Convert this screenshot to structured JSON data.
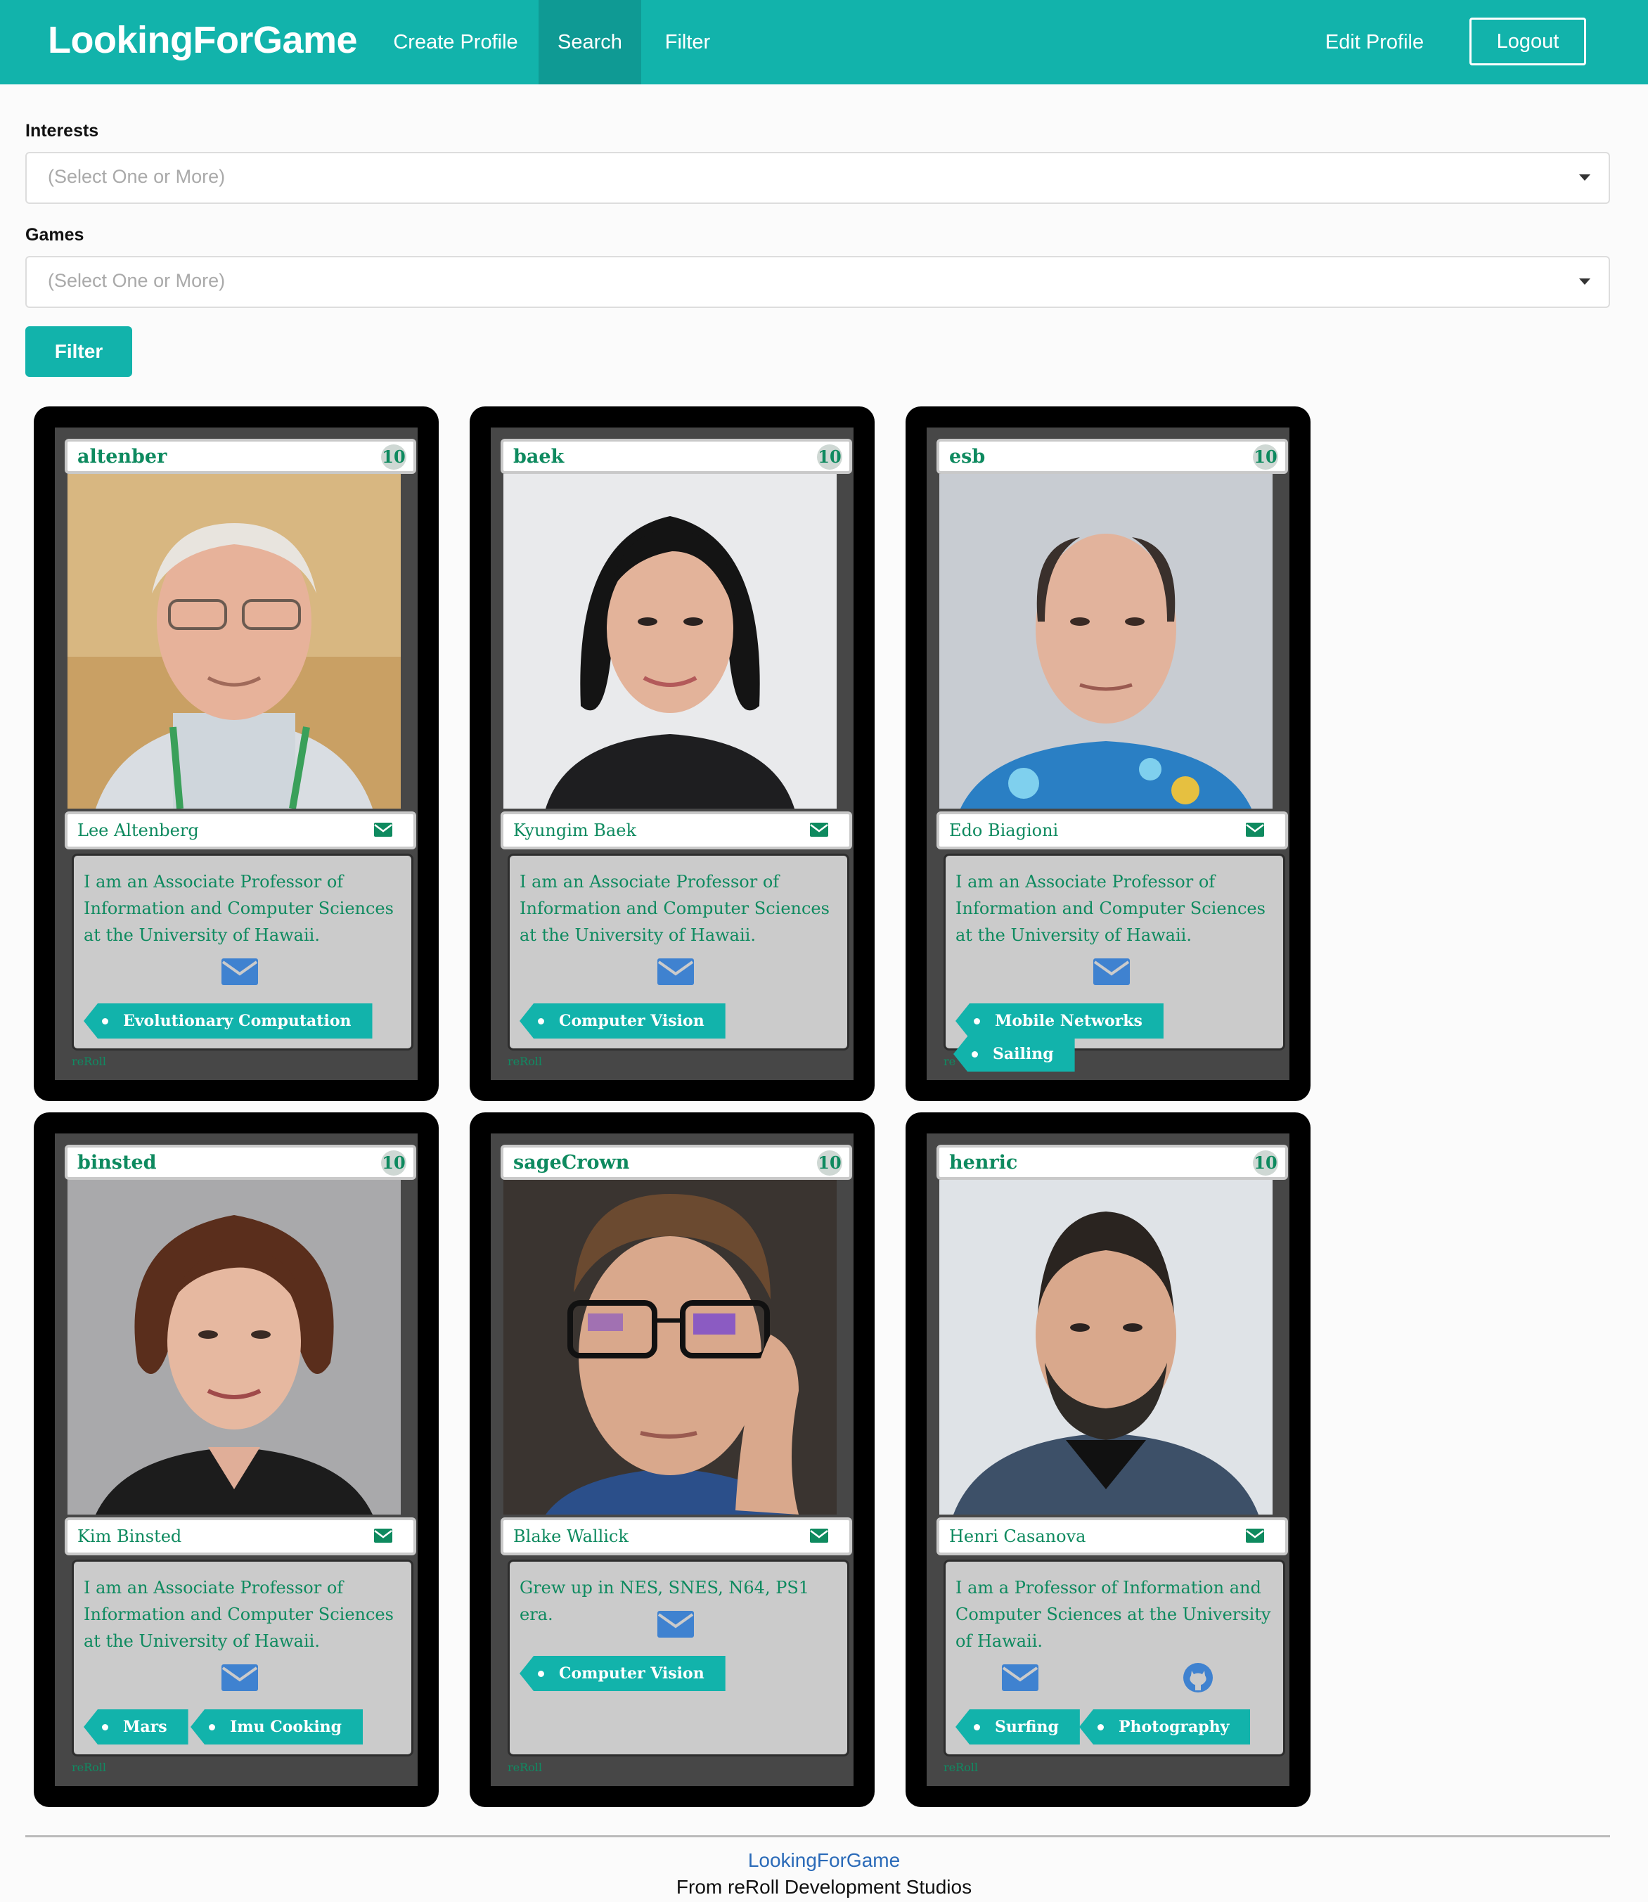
{
  "navbar": {
    "brand": "LookingForGame",
    "links": [
      "Create Profile",
      "Search",
      "Filter"
    ],
    "active": "Search",
    "edit_profile": "Edit Profile",
    "logout": "Logout",
    "bg_color": "#12b3ab"
  },
  "filters": {
    "interests_label": "Interests",
    "interests_placeholder": "(Select One or More)",
    "games_label": "Games",
    "games_placeholder": "(Select One or More)",
    "filter_button": "Filter"
  },
  "cards": [
    {
      "username": "altenber",
      "level": "10",
      "name": "Lee Altenberg",
      "bio": "I am an Associate Professor of Information and Computer Sciences at the University of Hawaii.",
      "tags": [
        "Evolutionary Computation"
      ],
      "watermark": "reRoll"
    },
    {
      "username": "baek",
      "level": "10",
      "name": "Kyungim Baek",
      "bio": "I am an Associate Professor of Information and Computer Sciences at the University of Hawaii.",
      "tags": [
        "Computer Vision"
      ],
      "watermark": "reRoll"
    },
    {
      "username": "esb",
      "level": "10",
      "name": "Edo Biagioni",
      "bio": "I am an Associate Professor of Information and Computer Sciences at the University of Hawaii.",
      "tags": [
        "Mobile Networks",
        "Sailing"
      ],
      "watermark": "re"
    },
    {
      "username": "binsted",
      "level": "10",
      "name": "Kim Binsted",
      "bio": "I am an Associate Professor of Information and Computer Sciences at the University of Hawaii.",
      "tags": [
        "Mars",
        "Imu Cooking"
      ],
      "watermark": "reRoll"
    },
    {
      "username": "sageCrown",
      "level": "10",
      "name": "Blake Wallick",
      "bio": "Grew up in NES, SNES, N64, PS1 era.",
      "tags": [
        "Computer Vision"
      ],
      "watermark": "reRoll"
    },
    {
      "username": "henric",
      "level": "10",
      "name": "Henri Casanova",
      "bio": "I am a Professor of Information and Computer Sciences at the University of Hawaii.",
      "tags": [
        "Surfing",
        "Photography"
      ],
      "watermark": "reRoll"
    }
  ],
  "footer": {
    "brand": "LookingForGame",
    "subtitle": "From reRoll Development Studios"
  }
}
